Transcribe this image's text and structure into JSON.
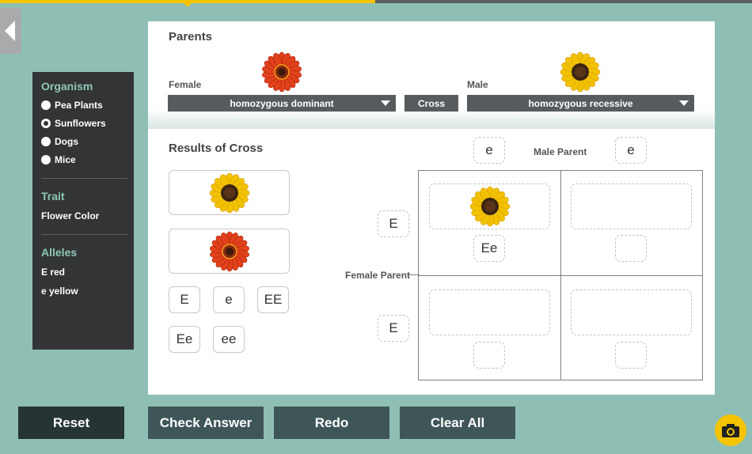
{
  "sidebar": {
    "organism_heading": "Organism",
    "organisms": [
      {
        "label": "Pea Plants",
        "selected": false
      },
      {
        "label": "Sunflowers",
        "selected": true
      },
      {
        "label": "Dogs",
        "selected": false
      },
      {
        "label": "Mice",
        "selected": false
      }
    ],
    "trait_heading": "Trait",
    "trait_value": "Flower Color",
    "alleles_heading": "Alleles",
    "alleles": [
      "E red",
      "e yellow"
    ]
  },
  "parents": {
    "title": "Parents",
    "female_label": "Female",
    "female_select": "homozygous dominant",
    "cross_label": "Cross",
    "male_label": "Male",
    "male_select": "homozygous recessive"
  },
  "results": {
    "title": "Results of Cross",
    "flowers": [
      "yellow-sunflower-icon",
      "red-sunflower-icon"
    ],
    "tiles": [
      "E",
      "e",
      "EE",
      "Ee",
      "ee"
    ]
  },
  "punnett": {
    "male_parent_label": "Male Parent",
    "female_parent_label": "Female Parent",
    "male_alleles": [
      "e",
      "e"
    ],
    "female_alleles": [
      "E",
      "E"
    ],
    "cells": [
      {
        "flower": "yellow-sunflower-icon",
        "genotype": "Ee"
      },
      {
        "flower": "",
        "genotype": ""
      },
      {
        "flower": "",
        "genotype": ""
      },
      {
        "flower": "",
        "genotype": ""
      }
    ]
  },
  "buttons": {
    "reset": "Reset",
    "check": "Check Answer",
    "redo": "Redo",
    "clear": "Clear All"
  },
  "colors": {
    "background": "#8fbfb4",
    "panel": "#333436",
    "accent": "#8fc7b7",
    "progress": "#f5c400",
    "button": "#3f5658",
    "reset_button": "#263534"
  }
}
